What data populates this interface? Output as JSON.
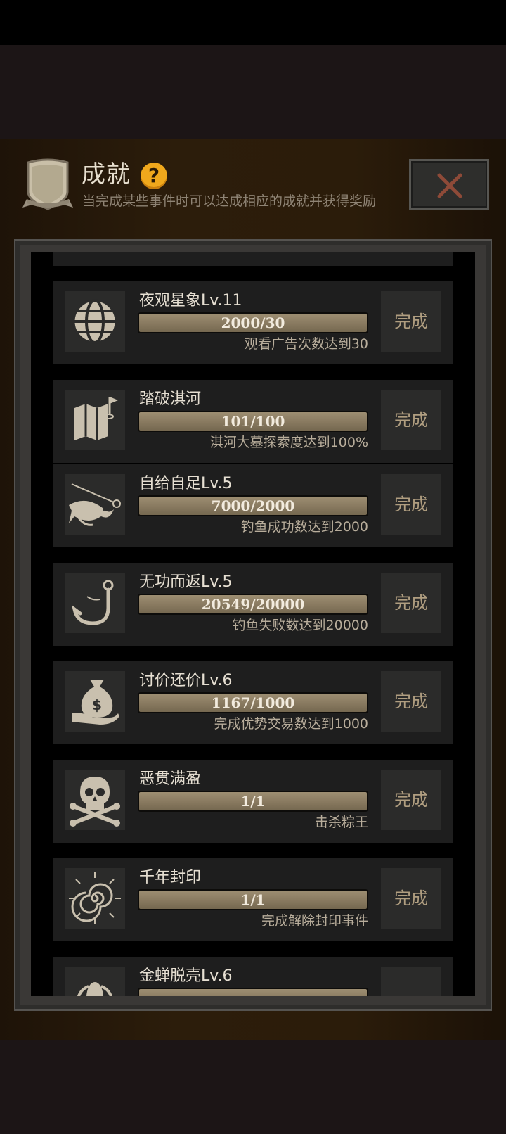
{
  "header": {
    "title": "成就",
    "help_label": "?",
    "subtitle": "当完成某些事件时可以达成相应的成就并获得奖励"
  },
  "colors": {
    "accent": "#f0a81c",
    "close_x": "#8e4a38",
    "progress_fill": "#8a7b61"
  },
  "achievements": [
    {
      "name": "夜观星象Lv.11",
      "icon": "globe-icon",
      "progress": "2000/30",
      "desc": "观看广告次数达到30",
      "action": "完成"
    },
    {
      "name": "踏破淇河",
      "icon": "map-flag-icon",
      "progress": "101/100",
      "desc": "淇河大墓探索度达到100%",
      "action": "完成"
    },
    {
      "name": "自给自足Lv.5",
      "icon": "fish-catch-icon",
      "progress": "7000/2000",
      "desc": "钓鱼成功数达到2000",
      "action": "完成"
    },
    {
      "name": "无功而返Lv.5",
      "icon": "fishhook-icon",
      "progress": "20549/20000",
      "desc": "钓鱼失败数达到20000",
      "action": "完成"
    },
    {
      "name": "讨价还价Lv.6",
      "icon": "money-bag-icon",
      "progress": "1167/1000",
      "desc": "完成优势交易数达到1000",
      "action": "完成"
    },
    {
      "name": "恶贯满盈",
      "icon": "skull-crossbones-icon",
      "progress": "1/1",
      "desc": "击杀粽王",
      "action": "完成"
    },
    {
      "name": "千年封印",
      "icon": "seal-spiral-icon",
      "progress": "1/1",
      "desc": "完成解除封印事件",
      "action": "完成"
    },
    {
      "name": "金蝉脱壳Lv.6",
      "icon": "cicada-icon",
      "progress": "",
      "desc": "",
      "action": ""
    }
  ]
}
